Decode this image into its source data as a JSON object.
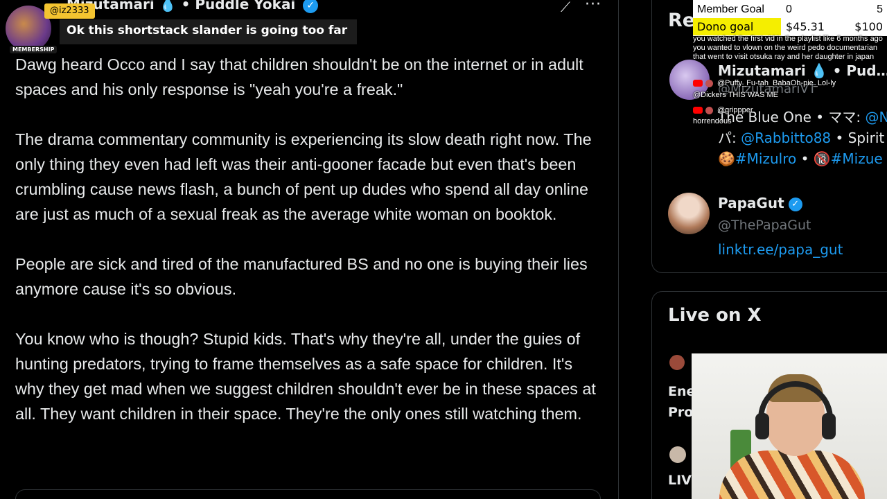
{
  "tweet": {
    "author_name": "Mizutamari",
    "author_drop": "💧",
    "author_suffix": "• Puddle Yokai",
    "verified_mark": "✓",
    "paragraphs": [
      "Dawg heard Occo and I say that children shouldn't be on the internet or in adult spaces and his only response is \"yeah you're a freak.\"",
      "The drama commentary community is experiencing its slow death right now. The only thing they even had left was their anti-gooner facade but even that's been crumbling cause news flash, a bunch of pent up dudes who spend all day online are just as much of a sexual freak as the average white woman on booktok.",
      "People are sick and tired of the manufactured BS and no one is buying their lies anymore cause it's so obvious.",
      "You know who is though? Stupid kids. That's why they're all, under the guies of hunting predators, trying to frame themselves as a safe space for children. It's why they get mad when we suggest children shouldn't ever be in these spaces at all. They want children in their space. They're the only ones still watching them."
    ]
  },
  "chat_overlay": {
    "username": "@iz2333 ",
    "message": "Ok this shortstack slander is going too far",
    "badge": "MEMBERSHIP"
  },
  "right_column": {
    "relevant_title": "Re",
    "profile1": {
      "name": "Mizutamari 💧 • Pud…",
      "handle": "@MizutamariVT",
      "bio_line1_prefix": "The Blue One • ママ: ",
      "bio_line1_link": "@N",
      "bio_line2_prefix": "パ: ",
      "bio_line2_link": "@Rabbitto88",
      "bio_line2_suffix": " • Spirit",
      "bio_line3_link1": "🍪#Mizulro",
      "bio_line3_sep": " • ",
      "bio_line3_link2": "🔞#Mizue"
    },
    "profile2": {
      "name": "PapaGut",
      "verified_mark": "✓",
      "handle": "@ThePapaGut",
      "link": "linktr.ee/papa_gut"
    },
    "live_title": "Live on X",
    "live_item1_label_1": "Ene",
    "live_item1_label_2": "Pro",
    "live_item2_label": "LIV"
  },
  "goals": {
    "member_label": "Member Goal",
    "member_current": "0",
    "member_max": "5",
    "dono_label": "Dono goal",
    "dono_current": "$45.31",
    "dono_max": "$100",
    "dono_progress": 0.4531,
    "dono_color": "#f5ee00"
  },
  "chat_feed": {
    "msg1": "you watched the first vid in the playlist like 6 months ago you wanted to vlown on the weird pedo documentarian that went to visit otsuka ray and her daughter in japan",
    "line2": "@Puffy_Fu-tah_BabaOh-pie_Lol-ly",
    "line3": "@Dickers THIS WAS ME",
    "line4": "@grippper",
    "line5": "horrendous"
  },
  "colors": {
    "accent": "#1d9bf0",
    "background": "#000000",
    "text": "#e7e9ea",
    "muted": "#71767b"
  }
}
